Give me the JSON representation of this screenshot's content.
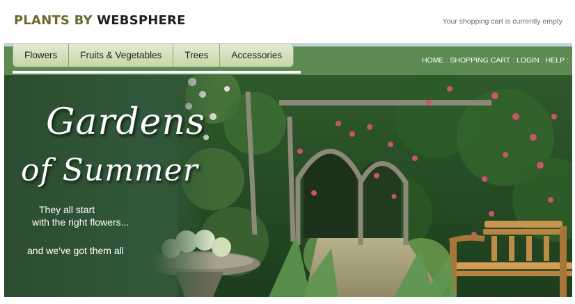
{
  "brand": {
    "part1": "PLANTS BY",
    "part2": "WEBSPHERE"
  },
  "cart": {
    "status": "Your shopping cart is currently empty"
  },
  "nav": {
    "tabs": [
      "Flowers",
      "Fruits & Vegetables",
      "Trees",
      "Accessories"
    ],
    "links": [
      "HOME",
      "SHOPPING CART",
      "LOGIN",
      "HELP"
    ],
    "separator": ":"
  },
  "hero": {
    "headline_line1": "Gardens",
    "headline_line2": "of Summer",
    "tagline_line1": "They all start",
    "tagline_line2": "with the right flowers...",
    "tagline_line3": "and we've got them all"
  },
  "colors": {
    "nav_green": "#5d8a52",
    "tab_bg": "#d6e3bd",
    "hero_dark_green": "#2f5232",
    "brand_olive": "#6b6a2e"
  }
}
